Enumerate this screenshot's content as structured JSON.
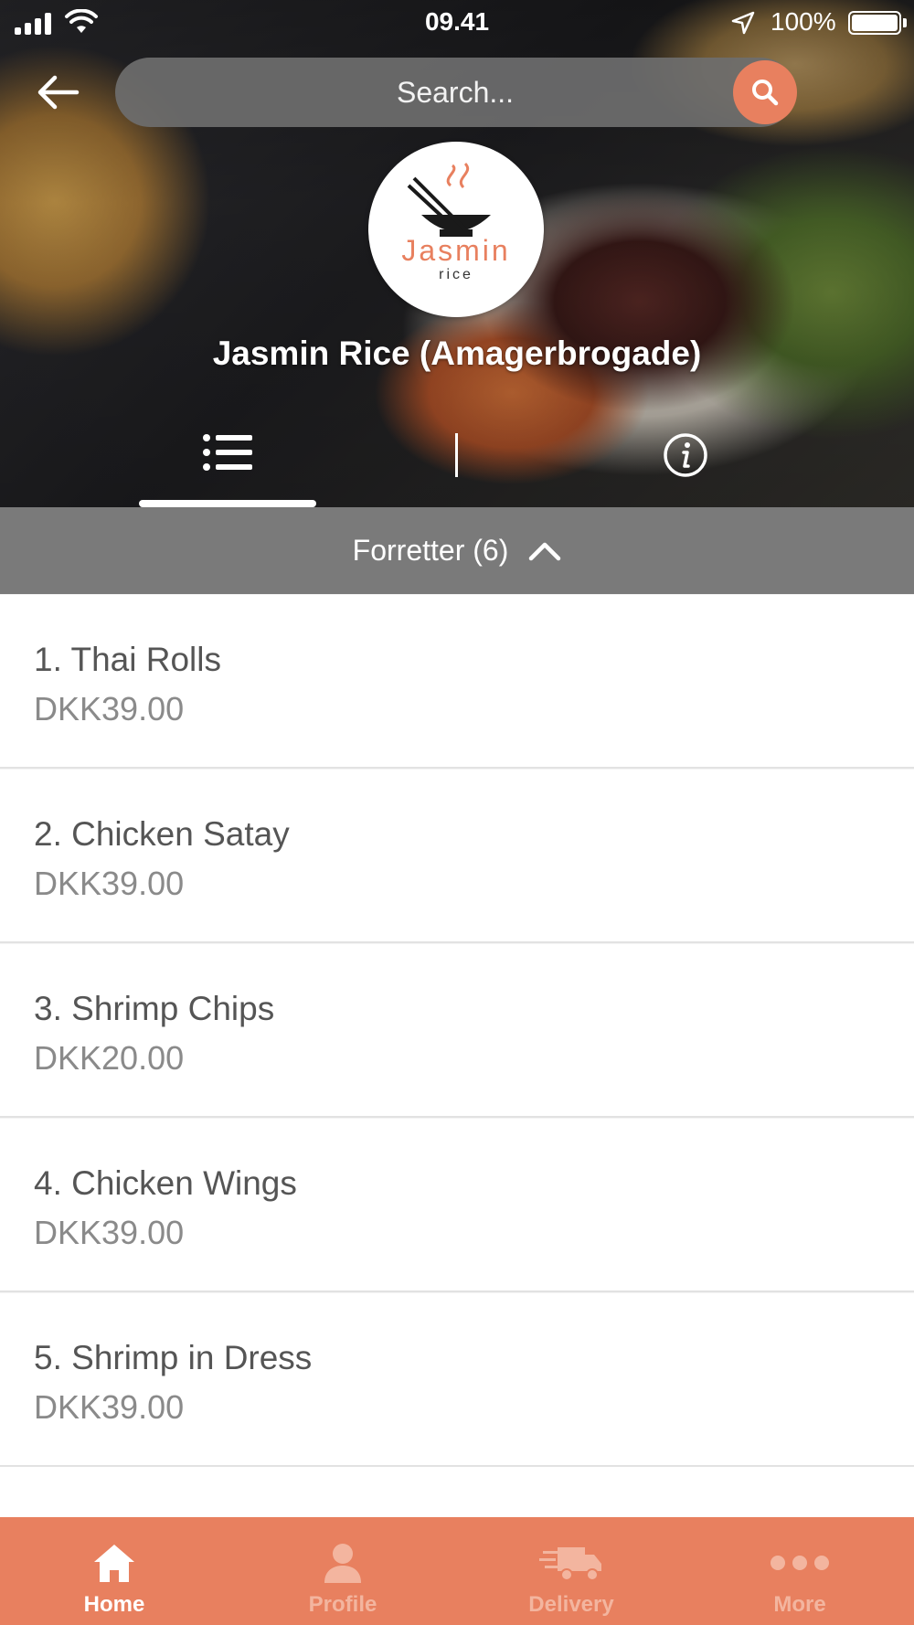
{
  "status_bar": {
    "time": "09.41",
    "battery_percent": "100%"
  },
  "search": {
    "placeholder": "Search..."
  },
  "restaurant": {
    "name": "Jasmin Rice (Amagerbrogade)",
    "logo_text_main": "Jasmin",
    "logo_text_sub": "rice"
  },
  "tabs": {
    "active": "menu-tab",
    "items": [
      "menu-list-icon",
      "info-icon"
    ]
  },
  "category": {
    "label": "Forretter (6)",
    "expanded": true
  },
  "menu_items": [
    {
      "name": "1. Thai Rolls",
      "price": "DKK39.00"
    },
    {
      "name": "2. Chicken Satay",
      "price": "DKK39.00"
    },
    {
      "name": "3. Shrimp Chips",
      "price": "DKK20.00"
    },
    {
      "name": "4. Chicken Wings",
      "price": "DKK39.00"
    },
    {
      "name": "5. Shrimp in Dress",
      "price": "DKK39.00"
    }
  ],
  "bottom_nav": {
    "items": [
      {
        "label": "Home",
        "icon": "home-icon",
        "active": true
      },
      {
        "label": "Profile",
        "icon": "profile-icon",
        "active": false
      },
      {
        "label": "Delivery",
        "icon": "delivery-truck-icon",
        "active": false
      },
      {
        "label": "More",
        "icon": "more-icon",
        "active": false
      }
    ]
  },
  "colors": {
    "accent": "#e8805f",
    "category_bar": "#7a7a7a",
    "search_bar": "#6e6e6e",
    "text_primary": "#555555",
    "text_secondary": "#8a8a8a"
  }
}
